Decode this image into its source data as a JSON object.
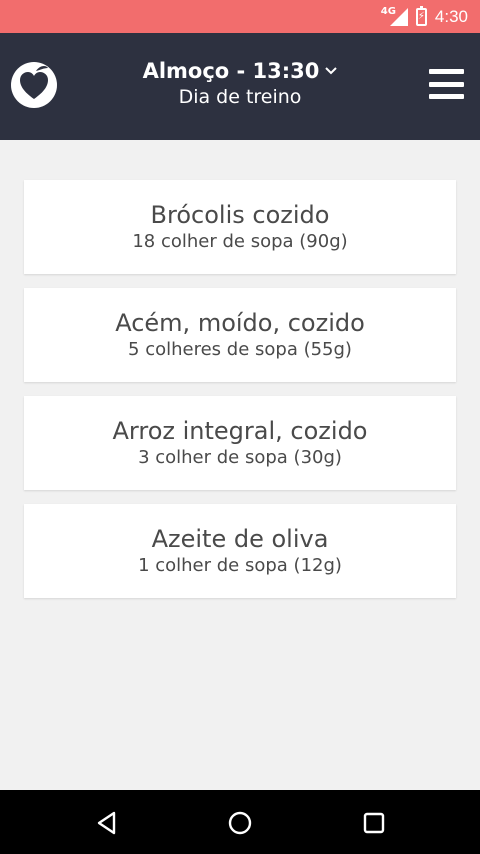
{
  "status_bar": {
    "network": "4G",
    "time": "4:30",
    "icons": [
      "signal-icon",
      "battery-charging-icon"
    ]
  },
  "app_bar": {
    "title": "Almoço - 13:30",
    "subtitle": "Dia de treino",
    "icons": [
      "app-logo-icon",
      "chevron-down-icon",
      "menu-icon"
    ]
  },
  "foods": [
    {
      "name": "Brócolis cozido",
      "portion": "18 colher de sopa (90g)"
    },
    {
      "name": "Acém, moído, cozido",
      "portion": "5 colheres de sopa (55g)"
    },
    {
      "name": "Arroz integral, cozido",
      "portion": "3 colher de sopa (30g)"
    },
    {
      "name": "Azeite de oliva",
      "portion": "1 colher de sopa (12g)"
    }
  ],
  "nav_bar": {
    "icons": [
      "back-icon",
      "home-icon",
      "recents-icon"
    ]
  },
  "colors": {
    "status_bar": "#f26d6d",
    "app_bar": "#2d3140",
    "background": "#f1f1f1",
    "card": "#ffffff",
    "text": "#4a4a4a"
  }
}
